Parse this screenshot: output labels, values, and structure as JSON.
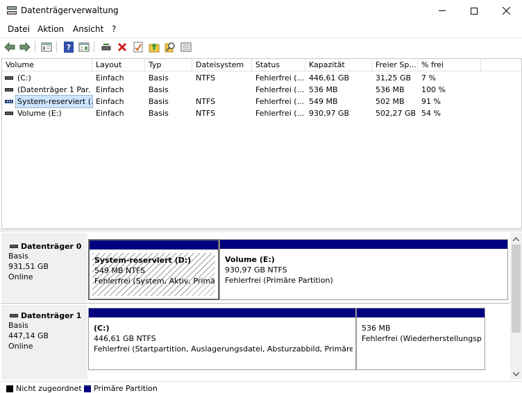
{
  "window": {
    "title": "Datenträgerverwaltung"
  },
  "menu": [
    "Datei",
    "Aktion",
    "Ansicht",
    "?"
  ],
  "toolbar": {
    "icons": [
      "back-icon",
      "forward-icon",
      "console-tree-icon",
      "help-icon",
      "properties-icon",
      "connect-icon",
      "delete-icon",
      "check-icon",
      "folder-up-icon",
      "search-icon",
      "list-icon"
    ]
  },
  "volume_list": {
    "columns": [
      "Volume",
      "Layout",
      "Typ",
      "Dateisystem",
      "Status",
      "Kapazität",
      "Freier Sp...",
      "% frei"
    ],
    "rows": [
      {
        "volume": "(C:)",
        "layout": "Einfach",
        "typ": "Basis",
        "dateisystem": "NTFS",
        "status": "Fehlerfrei (...",
        "kapazitaet": "446,61 GB",
        "frei": "31,25 GB",
        "prozent": "7 %"
      },
      {
        "volume": "(Datenträger 1 Par...",
        "layout": "Einfach",
        "typ": "Basis",
        "dateisystem": "",
        "status": "Fehlerfrei (...",
        "kapazitaet": "536 MB",
        "frei": "536 MB",
        "prozent": "100 %"
      },
      {
        "volume": "System-reserviert (...",
        "layout": "Einfach",
        "typ": "Basis",
        "dateisystem": "NTFS",
        "status": "Fehlerfrei (...",
        "kapazitaet": "549 MB",
        "frei": "502 MB",
        "prozent": "91 %"
      },
      {
        "volume": "Volume (E:)",
        "layout": "Einfach",
        "typ": "Basis",
        "dateisystem": "NTFS",
        "status": "Fehlerfrei (...",
        "kapazitaet": "930,97 GB",
        "frei": "502,27 GB",
        "prozent": "54 %"
      }
    ]
  },
  "disks": [
    {
      "name": "Datenträger 0",
      "type": "Basis",
      "size": "931,51 GB",
      "state": "Online",
      "partitions": [
        {
          "name": "System-reserviert  (D:)",
          "size": "549 MB NTFS",
          "status": "Fehlerfrei (System, Aktiv, Primäre Partition)"
        },
        {
          "name": "Volume  (E:)",
          "size": "930,97 GB NTFS",
          "status": "Fehlerfrei (Primäre Partition)"
        }
      ]
    },
    {
      "name": "Datenträger 1",
      "type": "Basis",
      "size": "447,14 GB",
      "state": "Online",
      "partitions": [
        {
          "name": "(C:)",
          "size": "446,61 GB NTFS",
          "status": "Fehlerfrei (Startpartition, Auslagerungsdatei, Absturzabbild, Primäre Partition)"
        },
        {
          "name": "",
          "size": "536 MB",
          "status": "Fehlerfrei (Wiederherstellungspartition)"
        }
      ]
    }
  ],
  "legend": [
    {
      "label": "Nicht zugeordnet",
      "color": "#000000"
    },
    {
      "label": "Primäre Partition",
      "color": "#000080"
    }
  ],
  "colors": {
    "primary_partition": "#000080",
    "selection": "#cce4ff"
  }
}
